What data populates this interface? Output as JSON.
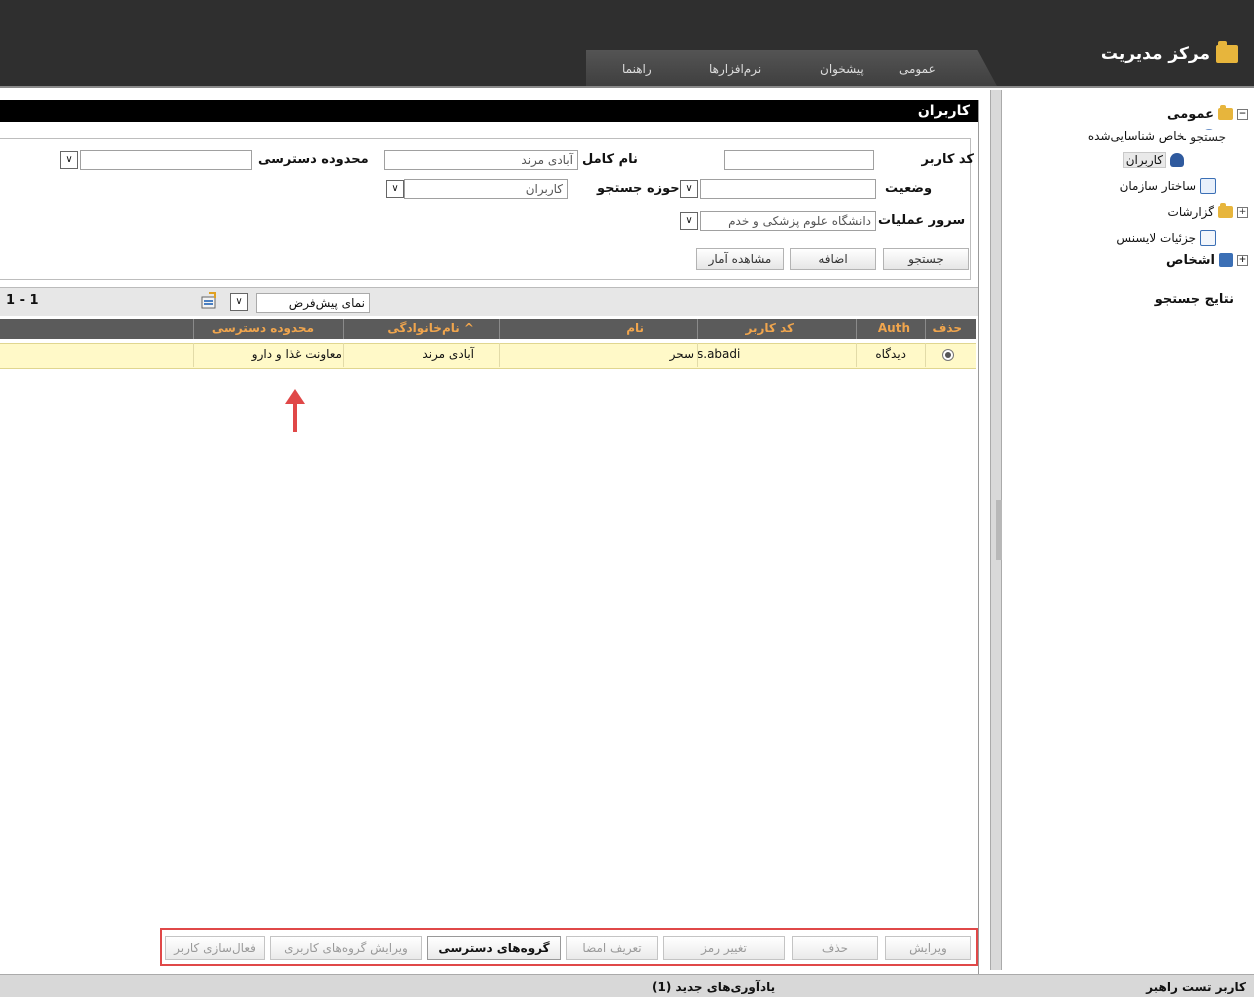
{
  "header": {
    "app_title": "مرکز مدیریت",
    "menu": [
      "عمومی",
      "پیشخوان",
      "نرم‌افزارها",
      "راهنما"
    ]
  },
  "sidebar": {
    "items": [
      {
        "label": "عمومی",
        "bold": true
      },
      {
        "label": "اشخاص شناسایی‌شده"
      },
      {
        "label": "کاربران",
        "selected": true
      },
      {
        "label": "ساختار سازمان"
      },
      {
        "label": "گزارشات"
      },
      {
        "label": "جزئیات لایسنس"
      },
      {
        "label": "اشخاص",
        "bold": true
      }
    ]
  },
  "panel": {
    "title": "کاربران",
    "search_legend": "جستجو",
    "fields": {
      "user_code_label": "کد کاربر",
      "user_code_value": "",
      "full_name_label": "نام کامل",
      "full_name_value": "آبادی مرند",
      "access_scope_label": "محدوده دسترسی",
      "access_scope_value": "",
      "status_label": "وضعیت",
      "status_value": "",
      "search_scope_label": "حوزه جستجو",
      "search_scope_value": "کاربران",
      "server_label": "سرور عملیات",
      "server_value": "دانشگاه علوم پزشکی و خدم"
    },
    "buttons": {
      "search": "جستجو",
      "add": "اضافه",
      "stats": "مشاهده آمار"
    }
  },
  "results": {
    "title": "نتایج جستجو",
    "view_select": "نمای پیش‌فرض",
    "count": "1 - 1",
    "columns": [
      "حذف",
      "Auth",
      "کد کاربر",
      "نام",
      "^ نام‌خانوادگی",
      "محدوده دسترسی"
    ],
    "rows": [
      {
        "auth": "دیدگاه",
        "user_code": "s.abadi",
        "first_name": "سحر",
        "last_name": "آبادی مرند",
        "access_scope": "معاونت غذا و دارو"
      }
    ]
  },
  "actions": [
    "ویرایش",
    "حذف",
    "تغییر رمز",
    "تعریف امضا",
    "گروه‌های دسترسی",
    "ویرایش گروه‌های کاربری",
    "فعال‌سازی کاربر"
  ],
  "status_bar": {
    "user": "کاربر  تست راهبر",
    "reminders": "یادآوری‌های جدید (1)"
  },
  "colors": {
    "header_bg": "#2f2f2f",
    "table_header_bg": "#5b5b5b",
    "table_header_text": "#f0a54d",
    "selected_row": "#fff9c8",
    "highlight_border": "#e04848"
  }
}
